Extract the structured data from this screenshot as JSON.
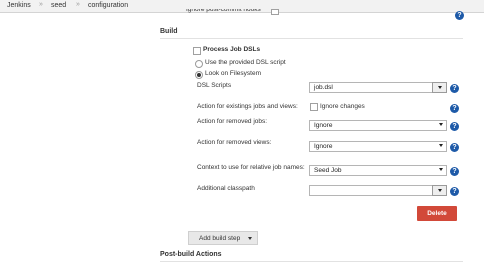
{
  "breadcrumb": {
    "items": [
      "Jenkins",
      "seed",
      "configuration"
    ],
    "separator": "»"
  },
  "top_row": {
    "label": "Ignore post-commit hooks"
  },
  "build": {
    "title": "Build",
    "step_title": "Process Job DSLs",
    "radio_provided": "Use the provided DSL script",
    "radio_filesystem": "Look on Filesystem",
    "dsl_scripts_label": "DSL Scripts",
    "dsl_scripts_value": "job.dsl",
    "existing_jobs_label": "Action for existings jobs and views:",
    "ignore_changes_label": "Ignore changes",
    "removed_jobs_label": "Action for removed jobs:",
    "removed_jobs_value": "Ignore",
    "removed_views_label": "Action for removed views:",
    "removed_views_value": "Ignore",
    "context_label": "Context to use for relative job names:",
    "context_value": "Seed Job",
    "classpath_label": "Additional classpath",
    "classpath_value": "",
    "delete_label": "Delete",
    "add_step_label": "Add build step"
  },
  "post_build": {
    "title": "Post-build Actions"
  },
  "help_glyph": "?",
  "colors": {
    "help_icon": "#1e5aa8",
    "delete_button": "#d24939"
  }
}
